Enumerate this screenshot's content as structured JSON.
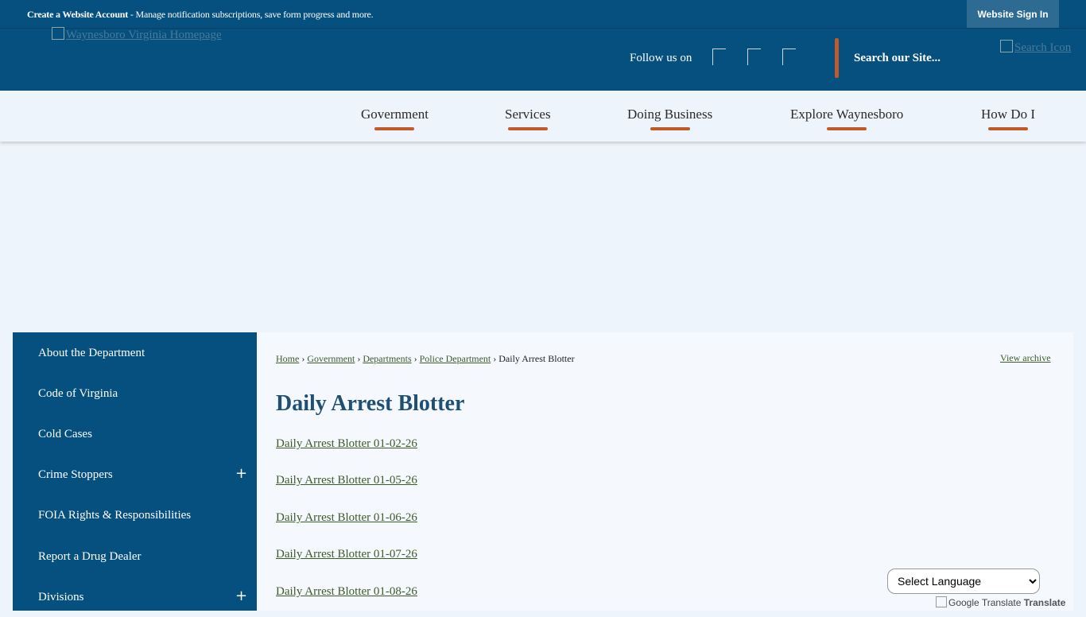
{
  "topbar": {
    "create_account": "Create a Website Account",
    "message": " - Manage notification subscriptions, save form progress and more.",
    "sign_in": "Website Sign In"
  },
  "header": {
    "logo_alt": "Waynesboro Virginia Homepage",
    "follow_label": "Follow us on",
    "search_placeholder": "Search our Site...",
    "search_icon_alt": "Search Icon"
  },
  "nav": {
    "items": [
      "Government",
      "Services",
      "Doing Business",
      "Explore Waynesboro",
      "How Do I"
    ]
  },
  "sidebar": {
    "items": [
      {
        "label": "About the Department"
      },
      {
        "label": "Code of Virginia"
      },
      {
        "label": "Cold Cases"
      },
      {
        "label": "Crime Stoppers",
        "expand": "+"
      },
      {
        "label": "FOIA Rights & Responsibilities"
      },
      {
        "label": "Report a Drug Dealer"
      },
      {
        "label": "Divisions",
        "expand": "+"
      }
    ]
  },
  "breadcrumb": {
    "items": [
      "Home",
      "Government",
      "Departments",
      "Police Department"
    ],
    "separator": "›",
    "current": "Daily Arrest Blotter"
  },
  "content": {
    "view_archive": "View archive",
    "title": "Daily Arrest Blotter",
    "links": [
      "Daily Arrest Blotter 01-02-26",
      "Daily Arrest Blotter 01-05-26",
      "Daily Arrest Blotter 01-06-26",
      "Daily Arrest Blotter 01-07-26",
      "Daily Arrest Blotter 01-08-26"
    ]
  },
  "translate": {
    "select_label": "Select Language",
    "google_alt": "Google Translate",
    "translate_label": "Translate"
  }
}
